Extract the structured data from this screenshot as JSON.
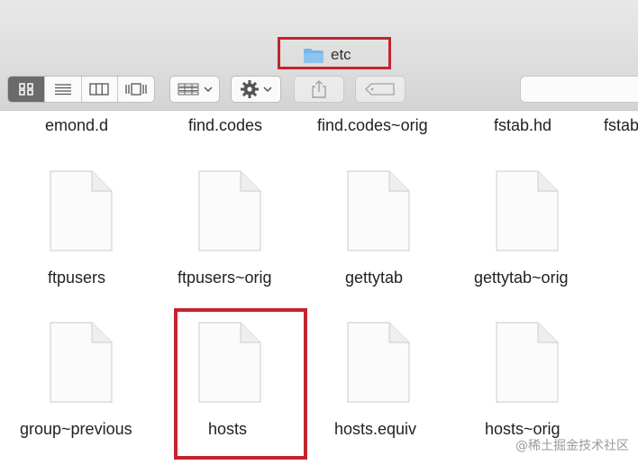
{
  "window": {
    "title": "etc"
  },
  "toolbar": {
    "view_modes": [
      {
        "name": "icon-view",
        "active": true
      },
      {
        "name": "list-view",
        "active": false
      },
      {
        "name": "column-view",
        "active": false
      },
      {
        "name": "gallery-view",
        "active": false
      }
    ],
    "search": {
      "placeholder": ""
    }
  },
  "files_top_row": [
    "emond.d",
    "find.codes",
    "find.codes~orig",
    "fstab.hd",
    "fstab"
  ],
  "files_row_2": [
    "ftpusers",
    "ftpusers~orig",
    "gettytab",
    "gettytab~orig"
  ],
  "files_row_3": [
    "group~previous",
    "hosts",
    "hosts.equiv",
    "hosts~orig"
  ],
  "watermark": "@稀土掘金技术社区",
  "colors": {
    "highlight": "#c4242f",
    "selected_view": "#6b6b6b",
    "folder": "#78b6e8"
  }
}
